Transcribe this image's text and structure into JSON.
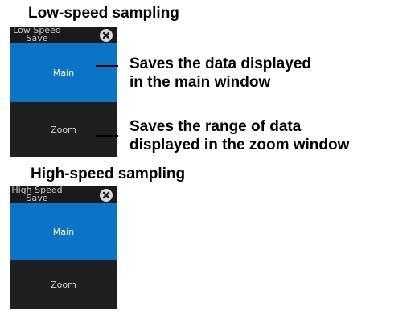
{
  "low": {
    "heading": "Low-speed sampling",
    "title_line1": "Low Speed",
    "title_line2": "Save Range",
    "option_main": "Main",
    "option_zoom": "Zoom"
  },
  "high": {
    "heading": "High-speed sampling",
    "title_line1": "High Speed",
    "title_line2": "Save Range",
    "option_main": "Main",
    "option_zoom": "Zoom"
  },
  "callouts": {
    "main_line1": "Saves the data displayed",
    "main_line2": "in the main window",
    "zoom_line1": "Saves the range of data",
    "zoom_line2": "displayed in the zoom window"
  },
  "colors": {
    "selected": "#0a74c6",
    "panel_bg": "#1a1a1a"
  },
  "icons": {
    "close": "close-icon"
  }
}
